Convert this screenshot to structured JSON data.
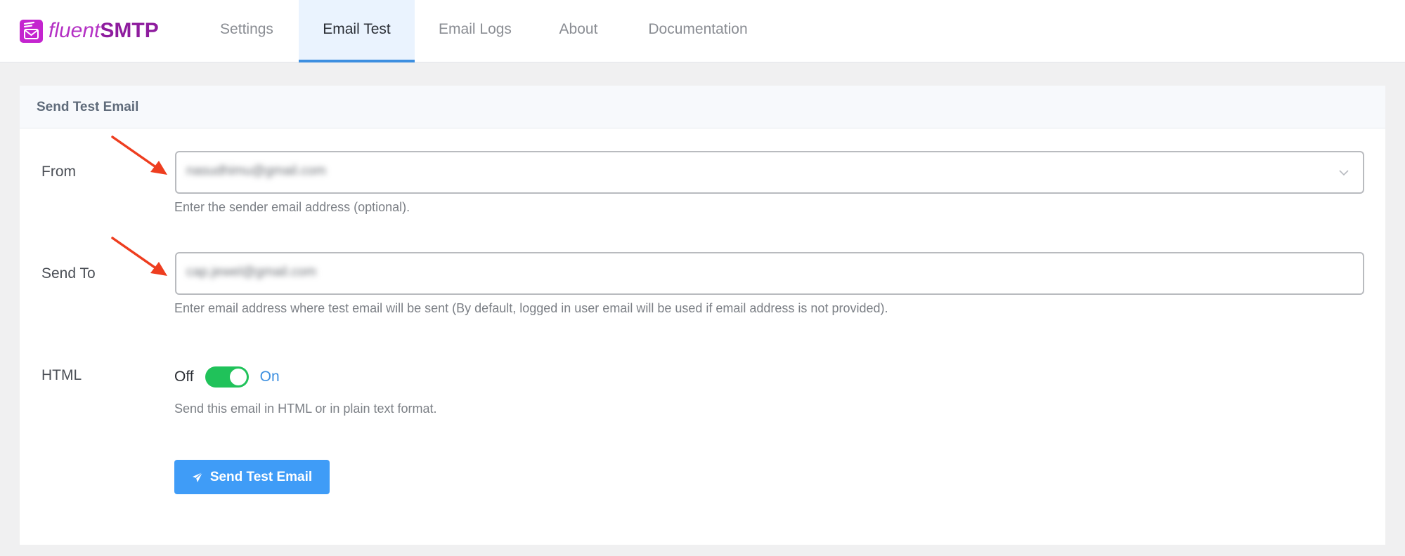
{
  "app": {
    "logo_text_light": "fluent",
    "logo_text_bold": "SMTP",
    "brand_color": "#8e1c9e"
  },
  "nav": {
    "items": [
      {
        "label": "Settings",
        "active": false
      },
      {
        "label": "Email Test",
        "active": true
      },
      {
        "label": "Email Logs",
        "active": false
      },
      {
        "label": "About",
        "active": false
      },
      {
        "label": "Documentation",
        "active": false
      }
    ]
  },
  "card": {
    "title": "Send Test Email",
    "from": {
      "label": "From",
      "value": "nasudhimu@gmail.com",
      "value_redacted": true,
      "help": "Enter the sender email address (optional)."
    },
    "send_to": {
      "label": "Send To",
      "value": "cap.jewel@gmail.com",
      "value_redacted": true,
      "help": "Enter email address where test email will be sent (By default, logged in user email will be used if email address is not provided)."
    },
    "html": {
      "label": "HTML",
      "off_label": "Off",
      "on_label": "On",
      "enabled": true,
      "help": "Send this email in HTML or in plain text format."
    },
    "submit_label": "Send Test Email"
  },
  "colors": {
    "accent": "#3f9cf7",
    "toggle_on": "#20c25a",
    "annotation_arrow": "#ee3d1f"
  }
}
